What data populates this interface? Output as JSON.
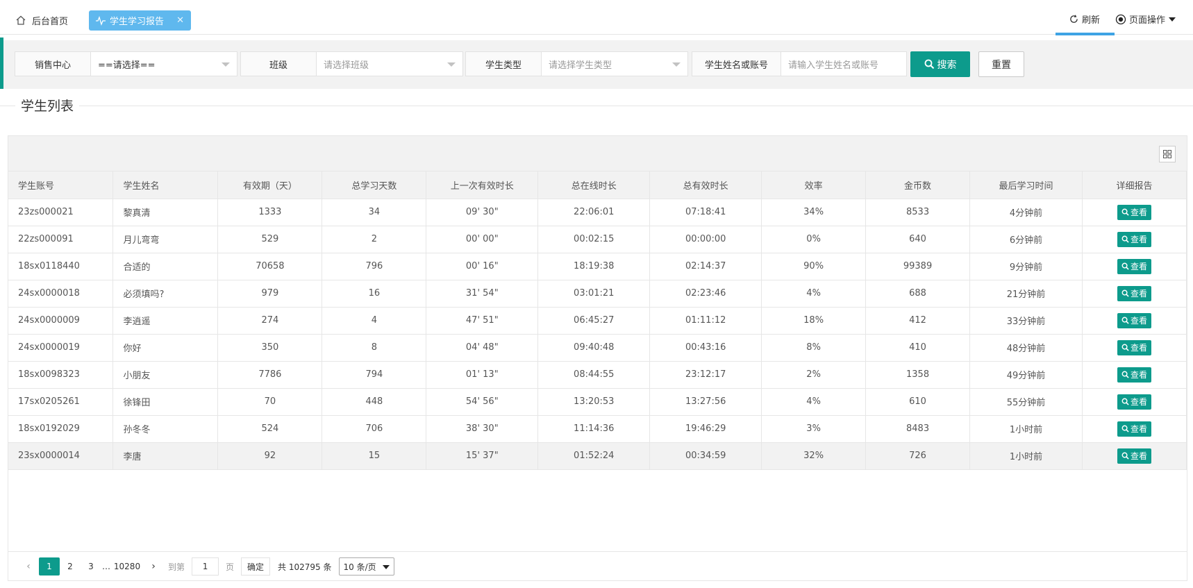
{
  "tabs": {
    "home": "后台首页",
    "active": "学生学习报告",
    "close": "✕",
    "refresh": "刷新",
    "page_ops": "页面操作"
  },
  "filters": {
    "sales_center": {
      "label": "销售中心",
      "value": "==请选择=="
    },
    "class": {
      "label": "班级",
      "placeholder": "请选择班级"
    },
    "student_type": {
      "label": "学生类型",
      "placeholder": "请选择学生类型"
    },
    "name_or_account": {
      "label": "学生姓名或账号",
      "placeholder": "请输入学生姓名或账号"
    },
    "search": "搜索",
    "reset": "重置"
  },
  "section_title": "学生列表",
  "table": {
    "columns": [
      "学生账号",
      "学生姓名",
      "有效期（天）",
      "总学习天数",
      "上一次有效时长",
      "总在线时长",
      "总有效时长",
      "效率",
      "金币数",
      "最后学习时间",
      "详细报告"
    ],
    "view_label": "查看",
    "rows": [
      [
        "23zs000021",
        "黎真清",
        "1333",
        "34",
        "09' 30\"",
        "22:06:01",
        "07:18:41",
        "34%",
        "8533",
        "4分钟前"
      ],
      [
        "22zs000091",
        "月儿弯弯",
        "529",
        "2",
        "00' 00\"",
        "00:02:15",
        "00:00:00",
        "0%",
        "640",
        "6分钟前"
      ],
      [
        "18sx0118440",
        "合适的",
        "70658",
        "796",
        "00' 16\"",
        "18:19:38",
        "02:14:37",
        "90%",
        "99389",
        "9分钟前"
      ],
      [
        "24sx0000018",
        "必须填吗?",
        "979",
        "16",
        "31' 54\"",
        "03:01:21",
        "02:23:46",
        "4%",
        "688",
        "21分钟前"
      ],
      [
        "24sx0000009",
        "李逍遥",
        "274",
        "4",
        "47' 51\"",
        "06:45:27",
        "01:11:12",
        "18%",
        "412",
        "33分钟前"
      ],
      [
        "24sx0000019",
        "你好",
        "350",
        "8",
        "04' 48\"",
        "09:40:48",
        "00:43:16",
        "8%",
        "410",
        "48分钟前"
      ],
      [
        "18sx0098323",
        "小朋友",
        "7786",
        "794",
        "01' 13\"",
        "08:44:55",
        "23:12:17",
        "2%",
        "1358",
        "49分钟前"
      ],
      [
        "17sx0205261",
        "徐锋田",
        "70",
        "448",
        "54' 56\"",
        "13:20:53",
        "13:27:56",
        "4%",
        "610",
        "55分钟前"
      ],
      [
        "18sx0192029",
        "孙冬冬",
        "524",
        "706",
        "38' 30\"",
        "11:14:36",
        "19:46:29",
        "3%",
        "8483",
        "1小时前"
      ],
      [
        "23sx0000014",
        "李唐",
        "92",
        "15",
        "15' 37\"",
        "01:52:24",
        "00:34:59",
        "32%",
        "726",
        "1小时前"
      ]
    ],
    "highlighted_row": 9
  },
  "pager": {
    "prev": "‹",
    "pages": [
      "1",
      "2",
      "3"
    ],
    "ellipsis": "…",
    "last_page": "10280",
    "next": "›",
    "goto_label": "到第",
    "goto_value": "1",
    "page_unit": "页",
    "confirm": "确定",
    "total": "共 102795 条",
    "page_size": "10 条/页"
  },
  "colors": {
    "accent": "#0d9b8c",
    "tab_active": "#5fb8ee",
    "tab_underline": "#3ea3e4"
  }
}
